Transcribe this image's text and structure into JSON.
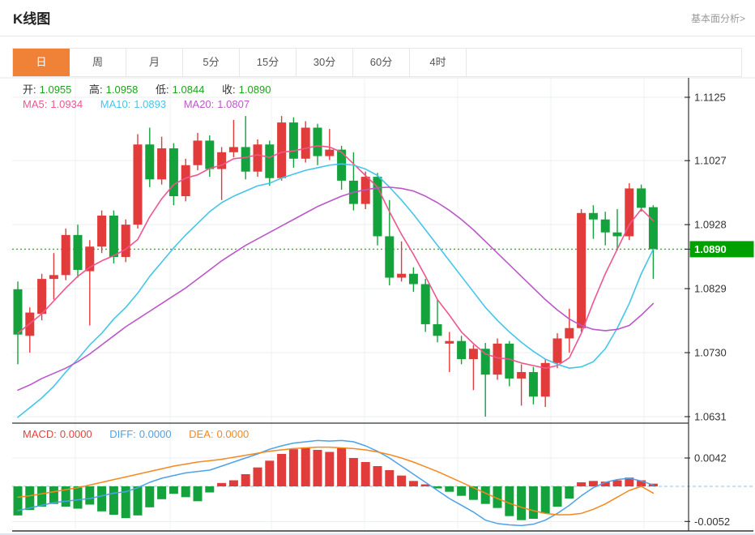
{
  "header": {
    "title": "K线图",
    "fundamental_link": "基本面分析>"
  },
  "tabs": {
    "items": [
      {
        "label": "日",
        "active": true
      },
      {
        "label": "周",
        "active": false
      },
      {
        "label": "月",
        "active": false
      },
      {
        "label": "5分",
        "active": false
      },
      {
        "label": "15分",
        "active": false
      },
      {
        "label": "30分",
        "active": false
      },
      {
        "label": "60分",
        "active": false
      },
      {
        "label": "4时",
        "active": false
      }
    ]
  },
  "ohlc_legend": {
    "open_label": "开:",
    "open_value": "1.0955",
    "high_label": "高:",
    "high_value": "1.0958",
    "low_label": "低:",
    "low_value": "1.0844",
    "close_label": "收:",
    "close_value": "1.0890"
  },
  "ma_legend": {
    "ma5_label": "MA5:",
    "ma5_value": "1.0934",
    "ma10_label": "MA10:",
    "ma10_value": "1.0893",
    "ma20_label": "MA20:",
    "ma20_value": "1.0807"
  },
  "macd_legend": {
    "macd_label": "MACD:",
    "macd_value": "0.0000",
    "diff_label": "DIFF:",
    "diff_value": "0.0000",
    "dea_label": "DEA:",
    "dea_value": "0.0000"
  },
  "colors": {
    "accent": "#ef8236",
    "up": "#e13b3b",
    "down": "#14a23c",
    "ohlc_value": "#1fa31f",
    "ma5": "#f0558e",
    "ma10": "#45c5ea",
    "ma20": "#bb58c8",
    "macd_value": "#e8413c",
    "diff": "#4da2e8",
    "dea": "#f5881f",
    "grid": "#e9eef5",
    "vgrid": "#eef1f5",
    "axis": "#333333",
    "tick_text": "#333333",
    "dotted_line": "#2eb82e",
    "zero_line": "#b5d8f0",
    "last_price_bg": "#00a000"
  },
  "chart_data": {
    "type": "candlestick",
    "title": "K线图",
    "interval": "日",
    "legend_position": "top-left",
    "grid": true,
    "price_axis": {
      "ticks": [
        1.1125,
        1.1027,
        1.0928,
        1.0829,
        1.073,
        1.0631
      ],
      "last_price": 1.089,
      "range": [
        1.0622,
        1.1156
      ]
    },
    "macd_axis": {
      "ticks": [
        0.0042,
        -0.0052
      ],
      "range": [
        -0.0068,
        0.0094
      ]
    },
    "current": {
      "open": 1.0955,
      "high": 1.0958,
      "low": 1.0844,
      "close": 1.089,
      "ma5": 1.0934,
      "ma10": 1.0893,
      "ma20": 1.0807,
      "macd": 0.0,
      "diff": 0.0,
      "dea": 0.0
    },
    "candles": [
      [
        1.0828,
        1.084,
        1.0712,
        1.0758
      ],
      [
        1.0756,
        1.08,
        1.073,
        1.0792
      ],
      [
        1.079,
        1.0852,
        1.078,
        1.0844
      ],
      [
        1.0844,
        1.0884,
        1.0812,
        1.085
      ],
      [
        1.085,
        1.0922,
        1.0842,
        1.0912
      ],
      [
        1.0912,
        1.0928,
        1.0846,
        1.0858
      ],
      [
        1.0856,
        1.0904,
        1.0772,
        1.0894
      ],
      [
        1.0894,
        1.095,
        1.0884,
        1.0942
      ],
      [
        1.0942,
        1.095,
        1.0868,
        1.0878
      ],
      [
        1.0878,
        1.0936,
        1.087,
        1.0928
      ],
      [
        1.0928,
        1.1068,
        1.0922,
        1.1052
      ],
      [
        1.1052,
        1.1078,
        1.0986,
        1.0998
      ],
      [
        1.0998,
        1.1064,
        1.099,
        1.1046
      ],
      [
        1.1046,
        1.1054,
        1.0958,
        1.0972
      ],
      [
        1.0972,
        1.103,
        1.0964,
        1.102
      ],
      [
        1.102,
        1.107,
        1.1012,
        1.1058
      ],
      [
        1.1058,
        1.1066,
        1.1002,
        1.1014
      ],
      [
        1.1014,
        1.1048,
        1.0966,
        1.104
      ],
      [
        1.104,
        1.109,
        1.1032,
        1.1048
      ],
      [
        1.1048,
        1.1096,
        1.0998,
        1.101
      ],
      [
        1.101,
        1.106,
        1.1002,
        1.1052
      ],
      [
        1.1052,
        1.1058,
        1.0988,
        1.1
      ],
      [
        1.1,
        1.1096,
        1.0996,
        1.1086
      ],
      [
        1.1086,
        1.1094,
        1.1016,
        1.103
      ],
      [
        1.103,
        1.1088,
        1.1024,
        1.1078
      ],
      [
        1.1078,
        1.1084,
        1.102,
        1.1034
      ],
      [
        1.1034,
        1.1076,
        1.1028,
        1.1044
      ],
      [
        1.1044,
        1.105,
        1.0982,
        1.0996
      ],
      [
        1.0996,
        1.104,
        1.095,
        1.096
      ],
      [
        1.096,
        1.101,
        1.0952,
        1.1002
      ],
      [
        1.1002,
        1.1008,
        1.0896,
        1.091
      ],
      [
        1.091,
        1.0966,
        1.0834,
        1.0846
      ],
      [
        1.0846,
        1.0902,
        1.084,
        1.0852
      ],
      [
        1.0852,
        1.0862,
        1.0824,
        1.0836
      ],
      [
        1.0836,
        1.0844,
        1.0762,
        1.0774
      ],
      [
        1.0774,
        1.0812,
        1.0746,
        1.0756
      ],
      [
        1.0744,
        1.0762,
        1.07,
        1.0748
      ],
      [
        1.0748,
        1.0756,
        1.0712,
        1.072
      ],
      [
        1.072,
        1.0742,
        1.0672,
        1.0736
      ],
      [
        1.0736,
        1.0745,
        1.0631,
        1.0696
      ],
      [
        1.0696,
        1.0752,
        1.0688,
        1.0744
      ],
      [
        1.0744,
        1.0748,
        1.0678,
        1.069
      ],
      [
        1.069,
        1.0712,
        1.0648,
        1.07
      ],
      [
        1.07,
        1.0708,
        1.065,
        1.0662
      ],
      [
        1.0662,
        1.072,
        1.0646,
        1.0714
      ],
      [
        1.0714,
        1.076,
        1.0706,
        1.0752
      ],
      [
        1.0752,
        1.0798,
        1.073,
        1.0768
      ],
      [
        1.0768,
        1.0952,
        1.0762,
        1.0946
      ],
      [
        1.0946,
        1.0958,
        1.0906,
        1.0936
      ],
      [
        1.0936,
        1.0948,
        1.0896,
        1.0916
      ],
      [
        1.0916,
        1.0952,
        1.0888,
        1.091
      ],
      [
        1.091,
        1.0992,
        1.0904,
        1.0984
      ],
      [
        1.0984,
        1.099,
        1.0948,
        1.0954
      ],
      [
        1.0955,
        1.0958,
        1.0844,
        1.089
      ]
    ],
    "ma5": [
      1.076,
      1.0775,
      1.079,
      1.081,
      1.083,
      1.0848,
      1.0862,
      1.0872,
      1.088,
      1.089,
      1.0905,
      1.094,
      1.0968,
      1.099,
      1.1,
      1.1005,
      1.1015,
      1.102,
      1.103,
      1.1032,
      1.1036,
      1.1032,
      1.104,
      1.1042,
      1.1046,
      1.105,
      1.1048,
      1.104,
      1.1022,
      1.1004,
      1.0986,
      1.0948,
      1.0913,
      1.0882,
      1.0848,
      1.0812,
      1.0788,
      1.0762,
      1.0744,
      1.0728,
      1.0722,
      1.072,
      1.0714,
      1.071,
      1.0706,
      1.071,
      1.0722,
      1.076,
      1.0808,
      1.0852,
      1.089,
      1.0928,
      1.0952,
      1.0934
    ],
    "ma10": [
      1.063,
      1.0645,
      1.066,
      1.0678,
      1.07,
      1.072,
      1.0742,
      1.076,
      1.0782,
      1.08,
      1.0822,
      1.0848,
      1.087,
      1.0892,
      1.0912,
      1.093,
      1.0948,
      1.0962,
      1.0972,
      1.098,
      1.0988,
      1.0992,
      1.1,
      1.1006,
      1.1012,
      1.1016,
      1.102,
      1.1022,
      1.102,
      1.1014,
      1.1004,
      1.0986,
      1.0966,
      1.0944,
      1.092,
      1.0896,
      1.0872,
      1.0848,
      1.0824,
      1.08,
      1.078,
      1.0762,
      1.0746,
      1.0732,
      1.072,
      1.0712,
      1.0706,
      1.0708,
      1.0716,
      1.0736,
      1.0768,
      1.0806,
      1.0852,
      1.089
    ],
    "ma20": [
      1.0672,
      1.068,
      1.069,
      1.0698,
      1.0706,
      1.0716,
      1.0728,
      1.0742,
      1.0756,
      1.077,
      1.0782,
      1.0794,
      1.0806,
      1.0818,
      1.083,
      1.0844,
      1.0858,
      1.0872,
      1.0884,
      1.0896,
      1.0906,
      1.0916,
      1.0926,
      1.0936,
      1.0946,
      1.0956,
      1.0964,
      1.0972,
      1.0978,
      1.0982,
      1.0985,
      1.0986,
      1.0984,
      1.098,
      1.0972,
      1.0962,
      1.095,
      1.0936,
      1.092,
      1.0902,
      1.0884,
      1.0866,
      1.0848,
      1.083,
      1.0812,
      1.0796,
      1.0782,
      1.0772,
      1.0766,
      1.0764,
      1.0766,
      1.0772,
      1.0788,
      1.0806
    ],
    "macd": {
      "histogram": [
        -0.0043,
        -0.0035,
        -0.003,
        -0.0026,
        -0.003,
        -0.0033,
        -0.0027,
        -0.0037,
        -0.0042,
        -0.0047,
        -0.0043,
        -0.0031,
        -0.0019,
        -0.0011,
        -0.0016,
        -0.0022,
        -0.0009,
        0.0005,
        0.0009,
        0.0018,
        0.0028,
        0.0038,
        0.0048,
        0.0055,
        0.0057,
        0.0054,
        0.0051,
        0.0057,
        0.0042,
        0.0036,
        0.003,
        0.0024,
        0.0016,
        0.0008,
        0.0003,
        -0.0003,
        -0.0008,
        -0.0014,
        -0.002,
        -0.0026,
        -0.0032,
        -0.0044,
        -0.005,
        -0.0048,
        -0.004,
        -0.003,
        -0.0018,
        0.0006,
        0.0008,
        0.0007,
        0.0009,
        0.0013,
        0.0009,
        0.0004
      ],
      "diff": [
        -0.0036,
        -0.0032,
        -0.0028,
        -0.0024,
        -0.0022,
        -0.002,
        -0.0018,
        -0.0014,
        -0.001,
        -0.0008,
        -0.0002,
        0.0006,
        0.0012,
        0.0016,
        0.002,
        0.0022,
        0.0024,
        0.003,
        0.0036,
        0.0042,
        0.0048,
        0.0055,
        0.006,
        0.0064,
        0.0066,
        0.0068,
        0.0067,
        0.0068,
        0.0066,
        0.006,
        0.0052,
        0.0042,
        0.003,
        0.0018,
        0.0006,
        -0.0006,
        -0.0018,
        -0.0028,
        -0.0038,
        -0.005,
        -0.0055,
        -0.0057,
        -0.0058,
        -0.0056,
        -0.005,
        -0.004,
        -0.0028,
        -0.0014,
        -0.0002,
        0.0006,
        0.001,
        0.0012,
        0.0008,
        0.0002
      ],
      "dea": [
        -0.0016,
        -0.0014,
        -0.0011,
        -0.0008,
        -0.0005,
        -0.0002,
        0.0002,
        0.0006,
        0.001,
        0.0014,
        0.0018,
        0.0022,
        0.0026,
        0.003,
        0.0033,
        0.0036,
        0.0038,
        0.004,
        0.0043,
        0.0046,
        0.0049,
        0.0052,
        0.0054,
        0.0056,
        0.0057,
        0.0058,
        0.0058,
        0.0057,
        0.0056,
        0.0054,
        0.0051,
        0.0047,
        0.0042,
        0.0036,
        0.0029,
        0.0022,
        0.0014,
        0.0006,
        -0.0002,
        -0.001,
        -0.0018,
        -0.0025,
        -0.0031,
        -0.0036,
        -0.004,
        -0.0042,
        -0.0042,
        -0.004,
        -0.0034,
        -0.0026,
        -0.0016,
        -0.0006,
        0.0,
        -0.001
      ]
    }
  }
}
